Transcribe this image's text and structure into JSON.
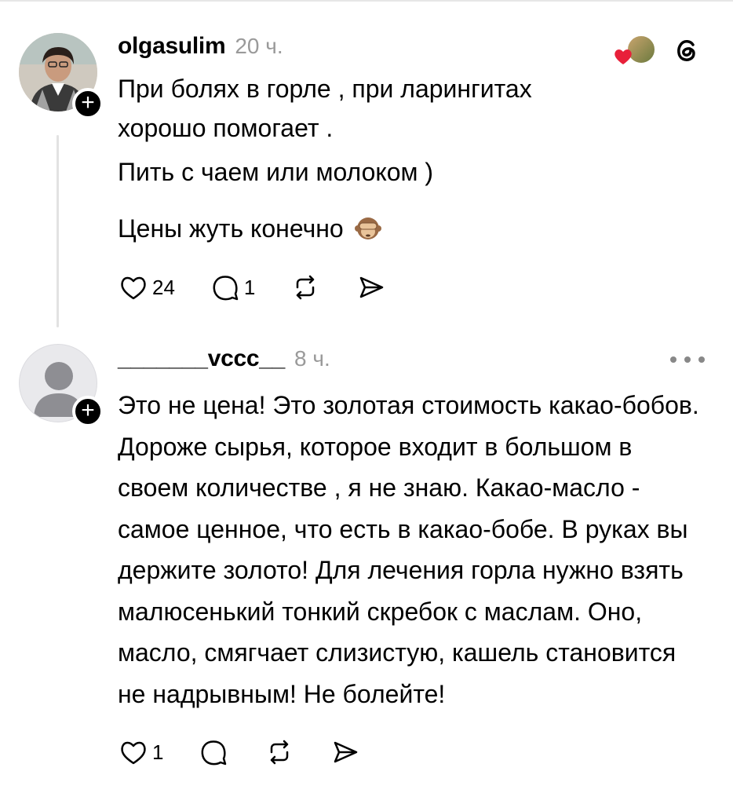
{
  "posts": [
    {
      "username": "olgasulim",
      "time": "20 ч.",
      "paragraphs": [
        "При болях в горле , при ларингитах хорошо помогает .",
        "Пить с чаем или молоком )",
        "Цены жуть конечно"
      ],
      "emoji": "see-no-evil-monkey",
      "likes": "24",
      "replies": "1",
      "icons": [
        "heart-icon",
        "comment-icon",
        "repost-icon",
        "share-icon"
      ]
    },
    {
      "username": "_______vccc__",
      "time": "8 ч.",
      "text": "Это не цена! Это золотая стоимость какао-бобов. Дороже сырья, которое входит в большом в своем количестве , я не знаю. Какао-масло - самое ценное, что есть в какао-бобе. В руках вы держите золото! Для лечения горла нужно взять малюсенький тонкий скребок с маслам. Оно, масло, смягчает слизистую, кашель становится не надрывным! Не болейте!",
      "likes": "1",
      "replies": "",
      "icons": [
        "heart-icon",
        "comment-icon",
        "repost-icon",
        "share-icon"
      ]
    }
  ],
  "follow_symbol": "+",
  "colors": {
    "heart": "#e8203a",
    "muted": "#9a9a9a",
    "line": "#e2e2e2"
  }
}
